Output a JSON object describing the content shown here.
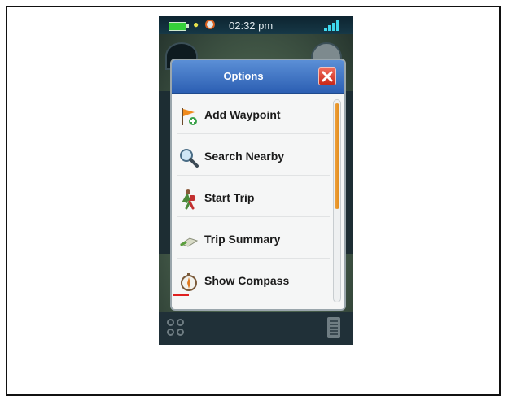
{
  "status_bar": {
    "time": "02:32 pm",
    "battery_icon": "battery-icon",
    "signal_icon": "signal-icon"
  },
  "dialog": {
    "title": "Options",
    "close_icon": "close-icon",
    "header_color": "#2c5fb3",
    "close_color": "#d33a2b"
  },
  "menu": {
    "items": [
      {
        "label": "Add Waypoint",
        "icon": "flag-add-icon"
      },
      {
        "label": "Search Nearby",
        "icon": "magnifier-icon"
      },
      {
        "label": "Start Trip",
        "icon": "hiker-icon"
      },
      {
        "label": "Trip Summary",
        "icon": "trip-summary-icon"
      },
      {
        "label": "Show Compass",
        "icon": "compass-icon"
      }
    ],
    "scroll_accent": "#e8921f"
  },
  "bottom_bar": {
    "apps_icon": "apps-icon",
    "list_icon": "list-icon"
  }
}
